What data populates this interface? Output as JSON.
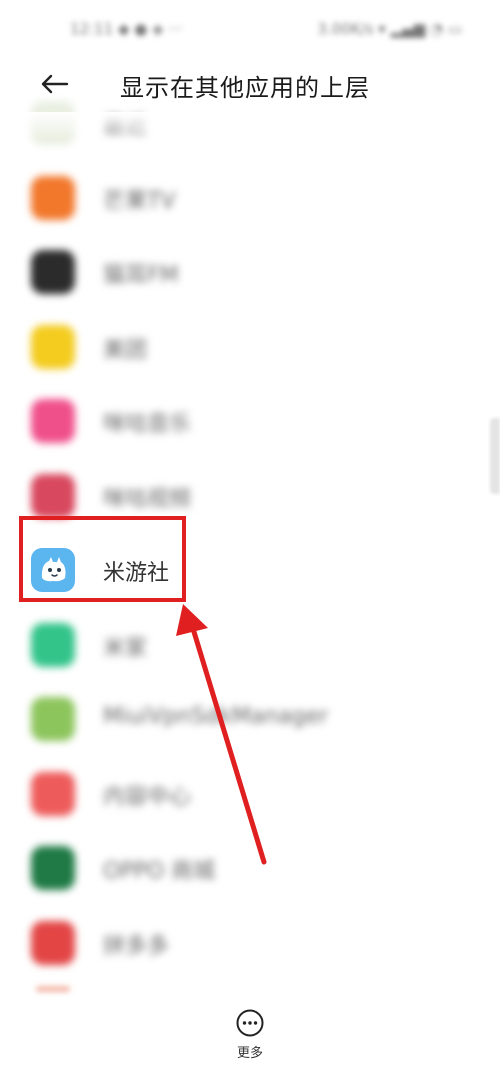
{
  "status_bar": {
    "left_text": "12:11 ◆ ● ◈ ···",
    "right_text": "3.00K/s ▾ ▂▄▆ ◔ ▭"
  },
  "header": {
    "title": "显示在其他应用的上层"
  },
  "apps": [
    {
      "name": "最近",
      "color": "#e9efe1",
      "blurred": true
    },
    {
      "name": "芒果TV",
      "color": "#f2782c",
      "blurred": true
    },
    {
      "name": "猫耳FM",
      "color": "#2b2b2b",
      "blurred": true
    },
    {
      "name": "美团",
      "color": "#f4cc1f",
      "blurred": true
    },
    {
      "name": "咪咕音乐",
      "color": "#f0508a",
      "blurred": true
    },
    {
      "name": "咪咕视频",
      "color": "#d8485e",
      "blurred": true
    },
    {
      "name": "米游社",
      "color": "#5bb6f0",
      "blurred": false
    },
    {
      "name": "米家",
      "color": "#33c48a",
      "blurred": true
    },
    {
      "name": "MiuiVpnSdkManager",
      "color": "#8dc55d",
      "blurred": true
    },
    {
      "name": "内容中心",
      "color": "#ee5b5b",
      "blurred": true
    },
    {
      "name": "OPPO 商城",
      "color": "#1f7a45",
      "blurred": true
    },
    {
      "name": "拼多多",
      "color": "#e34545",
      "blurred": true
    }
  ],
  "bottom_bar": {
    "more_label": "更多"
  },
  "colors": {
    "highlight": "#e02020"
  }
}
